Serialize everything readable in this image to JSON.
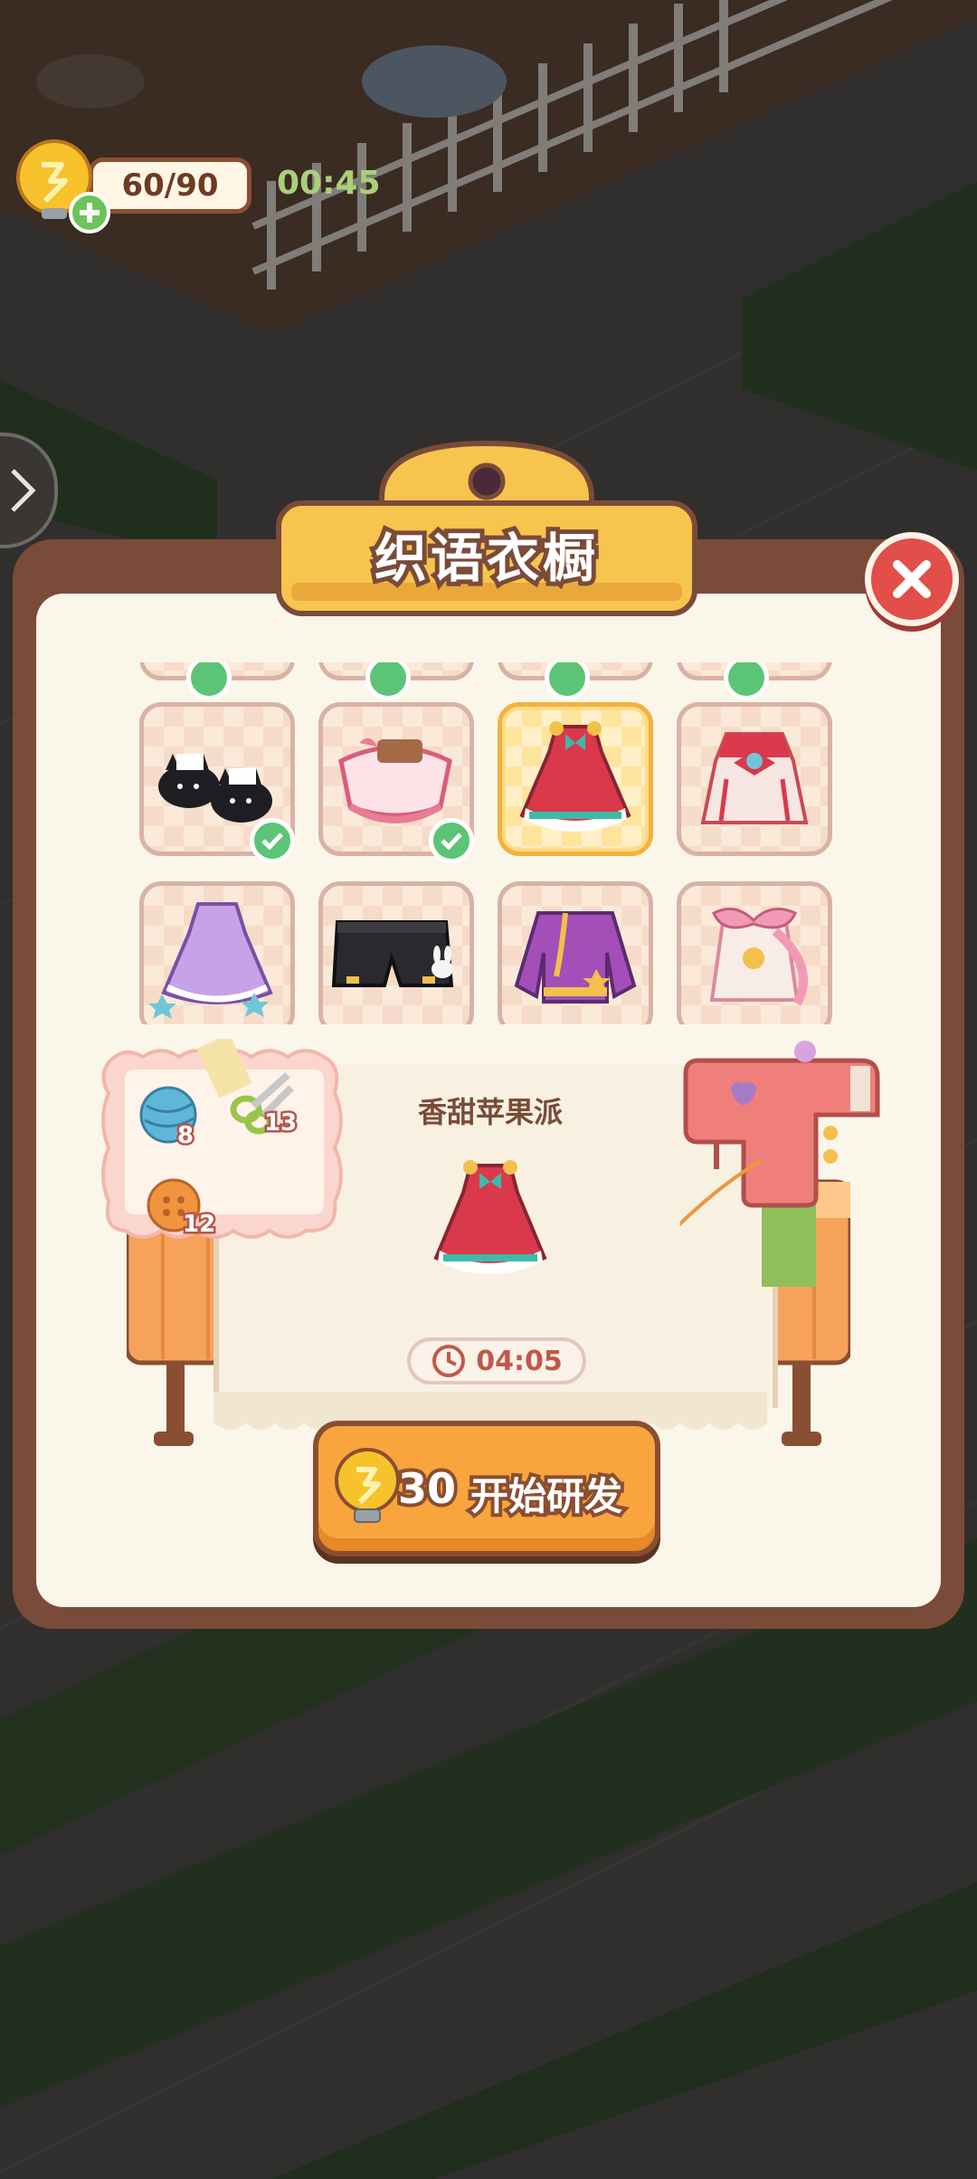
{
  "hud": {
    "energy": "60/90",
    "timer": "00:45",
    "add_icon": "plus-icon",
    "side_arrow_icon": "chevron-right-icon"
  },
  "panel": {
    "title": "织语衣橱",
    "close_icon": "close-icon"
  },
  "wardrobe": {
    "items": [
      {
        "name": "cat-slippers",
        "completed": true,
        "selected": false
      },
      {
        "name": "pink-frilly-skirt",
        "completed": true,
        "selected": false
      },
      {
        "name": "red-apple-dress",
        "completed": false,
        "selected": true
      },
      {
        "name": "red-white-dress",
        "completed": false,
        "selected": false
      },
      {
        "name": "purple-star-dress",
        "completed": false,
        "selected": false
      },
      {
        "name": "black-shorts",
        "completed": false,
        "selected": false
      },
      {
        "name": "purple-coat",
        "completed": false,
        "selected": false
      },
      {
        "name": "pink-bow-outfit",
        "completed": false,
        "selected": false
      }
    ]
  },
  "recipe": {
    "name": "香甜苹果派",
    "time": "04:05",
    "materials": [
      {
        "icon": "yarn-ball-icon",
        "count": "8"
      },
      {
        "icon": "scissors-icon",
        "count": "13"
      },
      {
        "icon": "button-icon",
        "count": "12"
      }
    ]
  },
  "start_button": {
    "cost": "30",
    "label": "开始研发"
  },
  "colors": {
    "panel_border": "#7a4b39",
    "panel_fill": "#fbf6ea",
    "accent_orange": "#f8a53d",
    "close_red": "#e24e4a",
    "check_green": "#5bc476",
    "timer_green": "#a8d07a"
  }
}
